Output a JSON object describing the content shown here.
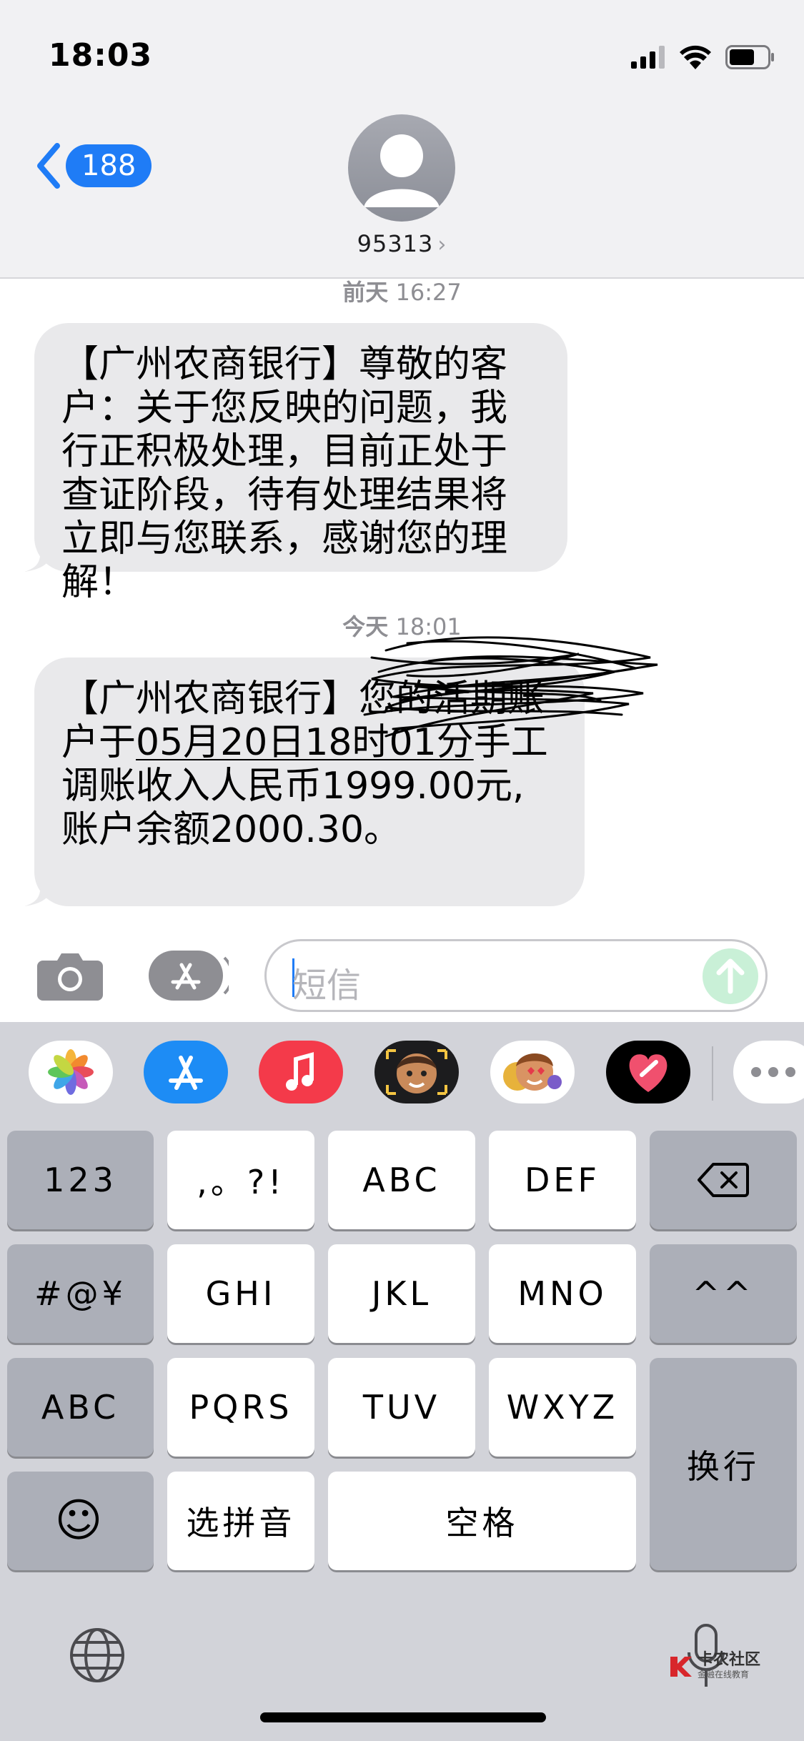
{
  "status_bar": {
    "time": "18:03"
  },
  "nav": {
    "back_count": "188",
    "contact": "95313",
    "contact_chevron": "›"
  },
  "messages": [
    {
      "timestamp_day": "前天",
      "timestamp_time": "16:27",
      "text": "【广州农商银行】尊敬的客户：关于您反映的问题，我行正积极处理，目前正处于查证阶段，待有处理结果将立即与您联系，感谢您的理解！"
    },
    {
      "timestamp_day": "今天",
      "timestamp_time": "18:01",
      "text_prefix": "【广州农商银行】您",
      "text_middle": "的活期账户于",
      "date_link": "05月20日18时01分",
      "text_after": "手工调账收入人民币1999.00元, 账户余额2000.30。"
    }
  ],
  "compose": {
    "placeholder": "短信"
  },
  "app_strip": [
    {
      "name": "photos-icon"
    },
    {
      "name": "app-store-icon"
    },
    {
      "name": "music-icon"
    },
    {
      "name": "memoji-icon"
    },
    {
      "name": "animoji-icon"
    },
    {
      "name": "digital-touch-icon"
    },
    {
      "name": "more-apps-icon"
    }
  ],
  "keyboard": {
    "row1": [
      "123",
      ",。?!",
      "ABC",
      "DEF"
    ],
    "row2": [
      "#@¥",
      "GHI",
      "JKL",
      "MNO",
      "^^"
    ],
    "row3": [
      "ABC",
      "PQRS",
      "TUV",
      "WXYZ"
    ],
    "row4": [
      "选拼音",
      "空格"
    ],
    "return": "换行",
    "emoji": "☺"
  },
  "watermark": {
    "title": "卡农社区",
    "subtitle": "金融在线教育"
  },
  "colors": {
    "accent": "#1f7cf6",
    "bubble": "#e9e9eb",
    "keyboard_bg": "#d2d3d9"
  }
}
